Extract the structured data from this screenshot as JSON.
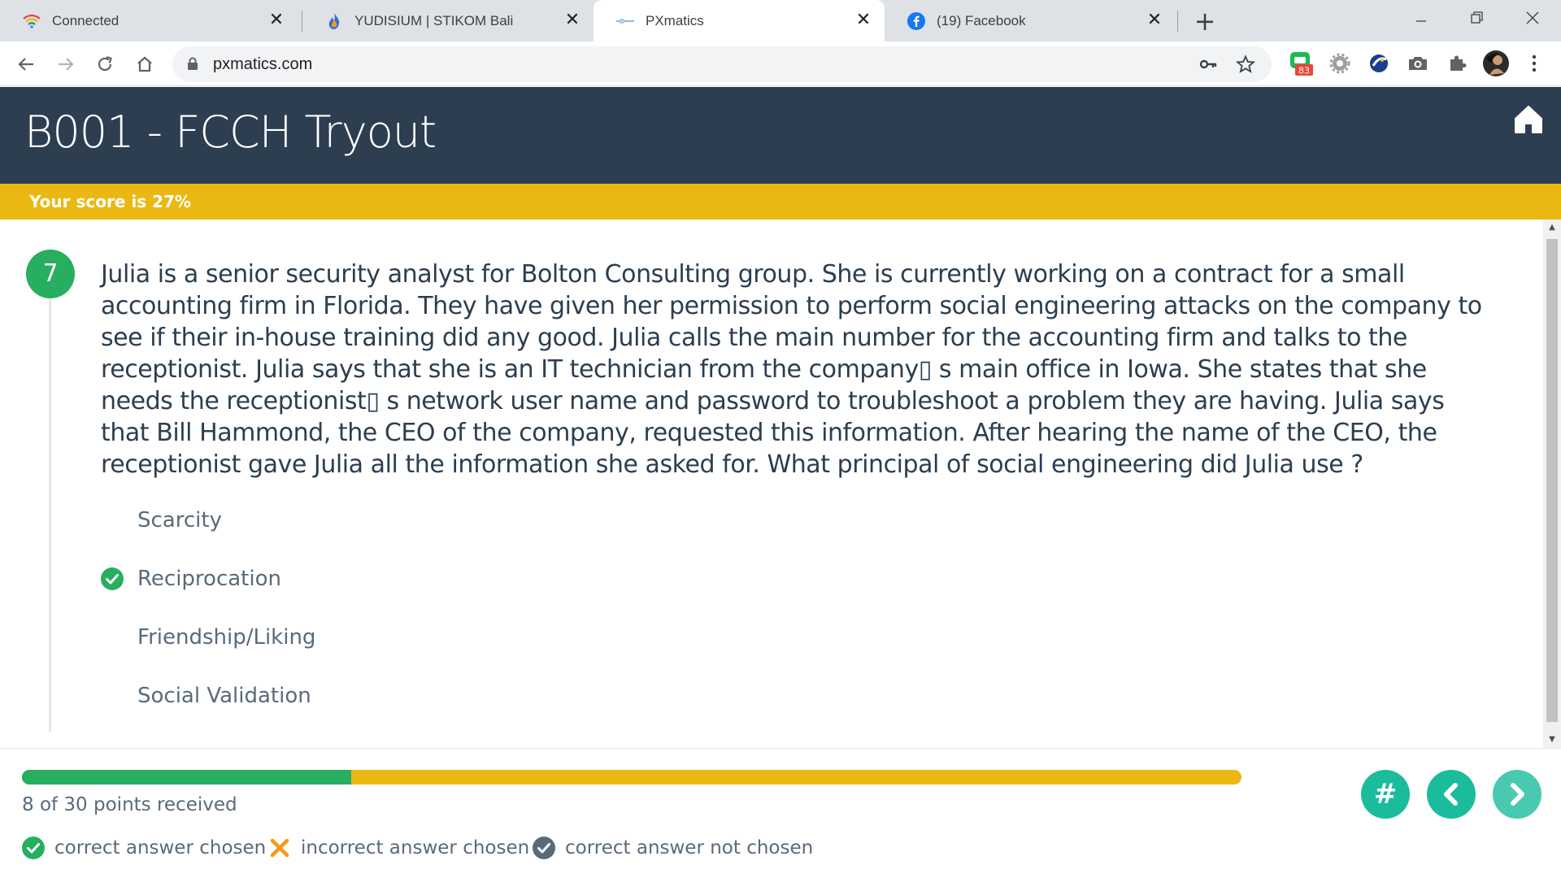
{
  "browser": {
    "tabs": [
      {
        "title": "Connected",
        "icon": "wifi-icon"
      },
      {
        "title": "YUDISIUM | STIKOM Bali",
        "icon": "flame-icon"
      },
      {
        "title": "PXmatics",
        "icon": "pxmatics-icon",
        "active": true
      },
      {
        "title": "(19) Facebook",
        "icon": "facebook-icon"
      }
    ],
    "new_tab": "+",
    "url": "pxmatics.com",
    "extension_badge": "83"
  },
  "app": {
    "title": "B001 - FCCH Tryout",
    "score_text": "Your score is 27%"
  },
  "question": {
    "number": "7",
    "text": "Julia is a senior security analyst for Bolton Consulting group. She is currently working on a contract for a small accounting firm in Florida. They have given her permission to perform social engineering attacks on the company to see if their in-house training did any good. Julia calls the main number for the accounting firm and talks to the receptionist. Julia says that she is an IT technician from the company▯ s main office in Iowa. She states that she needs the receptionist▯ s network user name and password to troubleshoot a problem they are having. Julia says that Bill Hammond, the CEO of the company, requested this information. After hearing the name of the CEO, the receptionist gave Julia all the information she asked for. What principal of social engineering did Julia use ?",
    "answers": [
      {
        "label": "Scarcity",
        "status": "none"
      },
      {
        "label": "Reciprocation",
        "status": "correct-chosen"
      },
      {
        "label": "Friendship/Liking",
        "status": "none"
      },
      {
        "label": "Social Validation",
        "status": "none"
      }
    ]
  },
  "footer": {
    "progress_fraction": 0.27,
    "points_text": "8 of 30 points received",
    "legend": [
      {
        "label": "correct answer chosen",
        "icon": "check-circle-green-icon"
      },
      {
        "label": "incorrect answer chosen",
        "icon": "cross-orange-icon"
      },
      {
        "label": "correct answer not chosen",
        "icon": "check-circle-gray-icon"
      }
    ],
    "buttons": {
      "grid": "#",
      "prev": "‹",
      "next": "›"
    }
  },
  "colors": {
    "header_bg": "#2c3e50",
    "score_bar": "#ebb813",
    "correct_green": "#27ae60",
    "nav_teal": "#1abc9c"
  }
}
